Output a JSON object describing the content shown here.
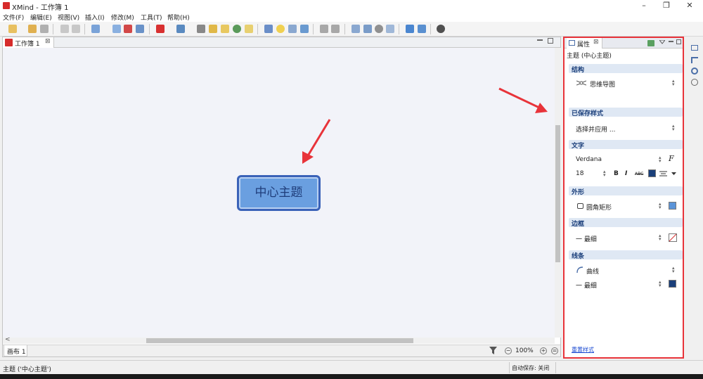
{
  "app": {
    "title": "XMind - 工作簿 1",
    "window_buttons": [
      "–",
      "❐",
      "✕"
    ]
  },
  "menu": [
    "文件(F)",
    "编辑(E)",
    "视图(V)",
    "插入(I)",
    "修改(M)",
    "工具(T)",
    "帮助(H)"
  ],
  "editor": {
    "tab_label": "工作簿 1",
    "tab_close": "⊠",
    "central_topic": "中心主题",
    "sheet_tab": "画布 1",
    "zoom": "100%",
    "scroll_left_arrow": "<"
  },
  "properties": {
    "tab_label": "属性",
    "tab_close": "⊠",
    "subtitle": "主题 (中心主题)",
    "sections": {
      "structure": {
        "title": "结构",
        "value": "思维导图"
      },
      "saved_style": {
        "title": "已保存样式",
        "value": "选择并应用 ..."
      },
      "text": {
        "title": "文字",
        "font": "Verdana",
        "font_button": "F",
        "size": "18",
        "bold": "B",
        "italic": "I",
        "strike": "ABC",
        "color": "#1a3f7a"
      },
      "shape": {
        "title": "外形",
        "value": "圆角矩形",
        "color": "#5b94d8"
      },
      "border": {
        "title": "边框",
        "value": "一 最细"
      },
      "line": {
        "title": "线条",
        "shape_value": "曲线",
        "width_value": "一 最细",
        "color": "#1a3f7a"
      }
    },
    "reset_link": "重置样式"
  },
  "status": {
    "left": "主题 ('中心主题')",
    "autosave": "自动保存: 关闭"
  },
  "colors": {
    "accent_red": "#e8333a",
    "topic_fill": "#6a9fe0",
    "topic_border": "#3a62b8",
    "canvas_bg": "#f2f3f9"
  }
}
